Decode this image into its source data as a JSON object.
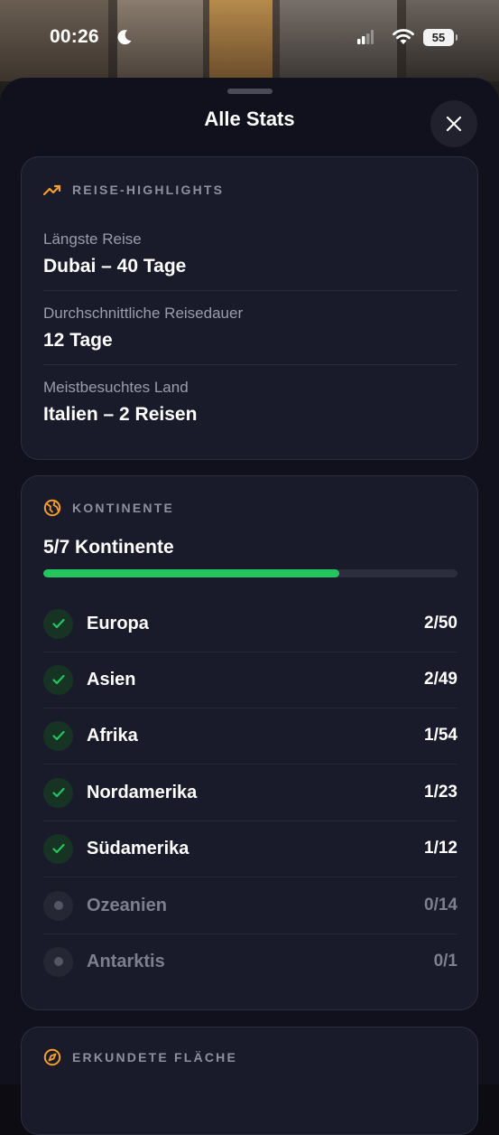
{
  "status_bar": {
    "time": "00:26",
    "battery": "55"
  },
  "sheet": {
    "title": "Alle Stats"
  },
  "highlights": {
    "header": "REISE-HIGHLIGHTS",
    "items": [
      {
        "label": "Längste Reise",
        "value": "Dubai – 40 Tage"
      },
      {
        "label": "Durchschnittliche Reisedauer",
        "value": "12 Tage"
      },
      {
        "label": "Meistbesuchtes Land",
        "value": "Italien – 2 Reisen"
      }
    ]
  },
  "continents": {
    "header": "KONTINENTE",
    "summary": "5/7 Kontinente",
    "progress_fraction": 0.714,
    "items": [
      {
        "name": "Europa",
        "count": "2/50",
        "visited": true
      },
      {
        "name": "Asien",
        "count": "2/49",
        "visited": true
      },
      {
        "name": "Afrika",
        "count": "1/54",
        "visited": true
      },
      {
        "name": "Nordamerika",
        "count": "1/23",
        "visited": true
      },
      {
        "name": "Südamerika",
        "count": "1/12",
        "visited": true
      },
      {
        "name": "Ozeanien",
        "count": "0/14",
        "visited": false
      },
      {
        "name": "Antarktis",
        "count": "0/1",
        "visited": false
      }
    ]
  },
  "area": {
    "header": "ERKUNDETE FLÄCHE"
  },
  "colors": {
    "accent_orange": "#f59e2b",
    "success_green": "#22c55e"
  }
}
